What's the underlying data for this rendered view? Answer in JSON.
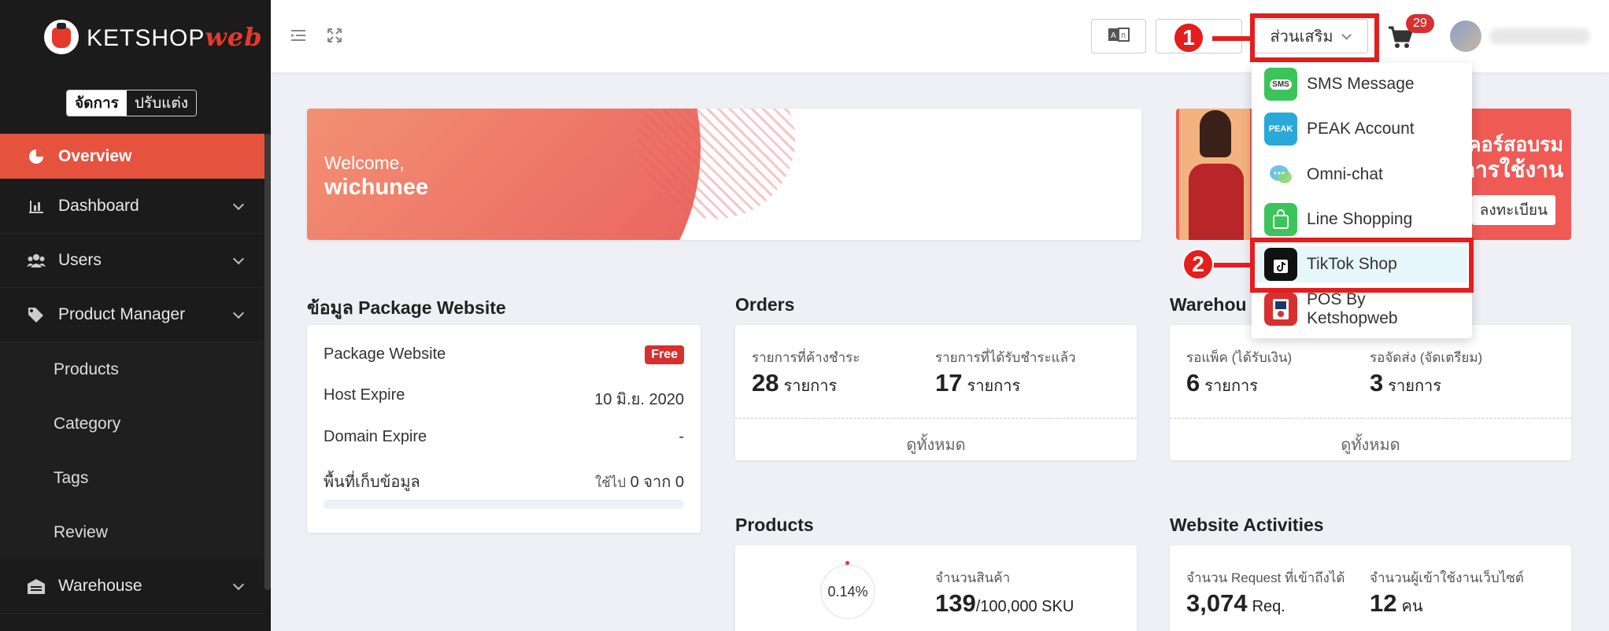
{
  "brand": {
    "name": "KETSHOP",
    "suffix": "web"
  },
  "mode": {
    "manage": "จัดการ",
    "customize": "ปรับแต่ง"
  },
  "sidebar": {
    "items": [
      {
        "label": "Overview",
        "icon": "pie-chart-icon",
        "active": true
      },
      {
        "label": "Dashboard",
        "icon": "bar-chart-icon"
      },
      {
        "label": "Users",
        "icon": "users-icon"
      },
      {
        "label": "Product Manager",
        "icon": "tags-icon"
      }
    ],
    "sub_items": [
      "Products",
      "Category",
      "Tags",
      "Review"
    ],
    "last_item": {
      "label": "Warehouse",
      "icon": "warehouse-icon"
    }
  },
  "header": {
    "addon_label": "ส่วนเสริม",
    "cart_count": "29",
    "lang_icon": "translate-icon"
  },
  "annotations": {
    "one": "1",
    "two": "2"
  },
  "dropdown": {
    "items": [
      {
        "label": "SMS Message",
        "icon": "sms-icon",
        "color": "#3cc35a",
        "tag": "SMS"
      },
      {
        "label": "PEAK Account",
        "icon": "peak-icon",
        "color": "#2aa8d8",
        "tag": "PEAK"
      },
      {
        "label": "Omni-chat",
        "icon": "chat-bubble-icon",
        "color": "#6cc5e8",
        "tag": ""
      },
      {
        "label": "Line Shopping",
        "icon": "shopping-bag-icon",
        "color": "#3cc35a",
        "tag": ""
      },
      {
        "label": "TikTok Shop",
        "icon": "tiktok-icon",
        "color": "#111111",
        "tag": ""
      },
      {
        "label": "POS By Ketshopweb",
        "icon": "pos-icon",
        "color": "#d63031",
        "tag": ""
      }
    ]
  },
  "welcome": {
    "greeting": "Welcome,",
    "name": "wichunee"
  },
  "training": {
    "line1": "คอร์สอบรม",
    "line2": "การใช้งาน",
    "register": "ลงทะเบียน"
  },
  "package": {
    "title": "ข้อมูล Package Website",
    "rows": [
      {
        "label": "Package Website",
        "value": "Free"
      },
      {
        "label": "Host Expire",
        "value": "10 มิ.ย. 2020"
      },
      {
        "label": "Domain Expire",
        "value": "-"
      },
      {
        "label": "พื้นที่เก็บข้อมูล",
        "value_prefix": "ใช้ไป",
        "used": "0",
        "mid": "จาก",
        "total": "0"
      }
    ],
    "storage_used_fraction": 0
  },
  "orders": {
    "title": "Orders",
    "pending_label": "รายการที่ค้างชำระ",
    "pending_value": "28",
    "paid_label": "รายการที่ได้รับชำระแล้ว",
    "paid_value": "17",
    "unit": "รายการ",
    "view_all": "ดูทั้งหมด"
  },
  "warehouse": {
    "title": "Warehou",
    "pack_label": "รอแพ็ค (ได้รับเงิน)",
    "pack_value": "6",
    "ship_label": "รอจัดส่ง (จัดเตรียม)",
    "ship_value": "3",
    "unit": "รายการ",
    "view_all": "ดูทั้งหมด"
  },
  "products": {
    "title": "Products",
    "percent": "0.14%",
    "count_label": "จำนวนสินค้า",
    "count": "139",
    "limit": "/100,000 SKU"
  },
  "activities": {
    "title": "Website Activities",
    "req_label": "จำนวน Request ที่เข้าถึงได้",
    "req_value": "3,074",
    "req_unit": "Req.",
    "visitors_label": "จำนวนผู้เข้าใช้งานเว็บไซต์",
    "visitors_value": "12",
    "visitors_unit": "คน"
  }
}
